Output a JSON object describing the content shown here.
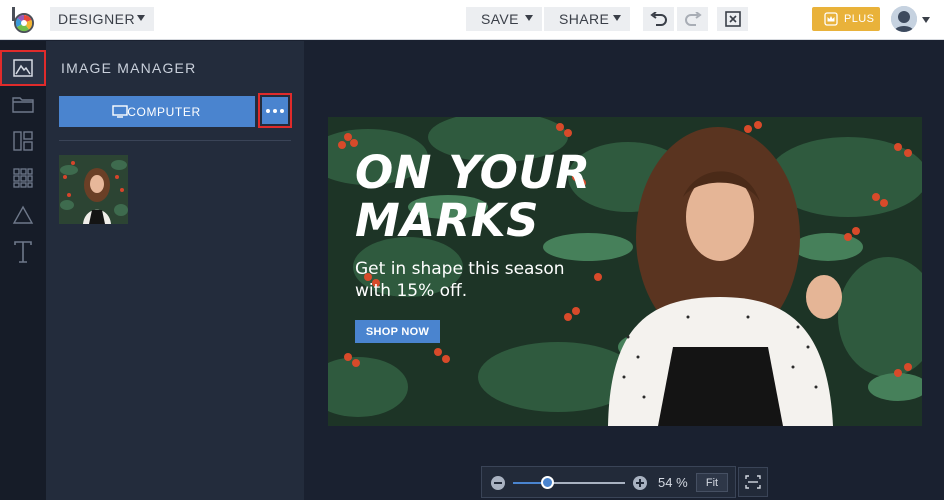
{
  "topbar": {
    "designer_label": "DESIGNER",
    "save_label": "SAVE",
    "share_label": "SHARE",
    "plus_label": "PLUS",
    "brand_color": "#e9b23a"
  },
  "rail": {
    "items": [
      {
        "icon": "image-icon",
        "active": true
      },
      {
        "icon": "folder-icon"
      },
      {
        "icon": "layout-icon"
      },
      {
        "icon": "grid-icon"
      },
      {
        "icon": "shapes-icon"
      },
      {
        "icon": "text-icon"
      }
    ]
  },
  "panel": {
    "title": "IMAGE MANAGER",
    "computer_label": "COMPUTER",
    "accent_color": "#4a84cf"
  },
  "design": {
    "headline_line1": "ON YOUR",
    "headline_line2": "MARKS",
    "subline": "Get in shape this season with 15% off.",
    "cta_label": "SHOP NOW"
  },
  "zoom": {
    "percent_label": "54 %",
    "level_fraction": 0.31,
    "fit_label": "Fit"
  }
}
